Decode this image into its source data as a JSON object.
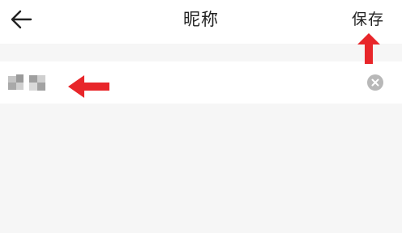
{
  "header": {
    "title": "昵称",
    "save_label": "保存",
    "back_icon": "arrow-left-icon"
  },
  "nickname_field": {
    "value": "",
    "clear_icon": "clear-circle-icon"
  },
  "annotations": {
    "arrow_color": "#e8262a"
  }
}
